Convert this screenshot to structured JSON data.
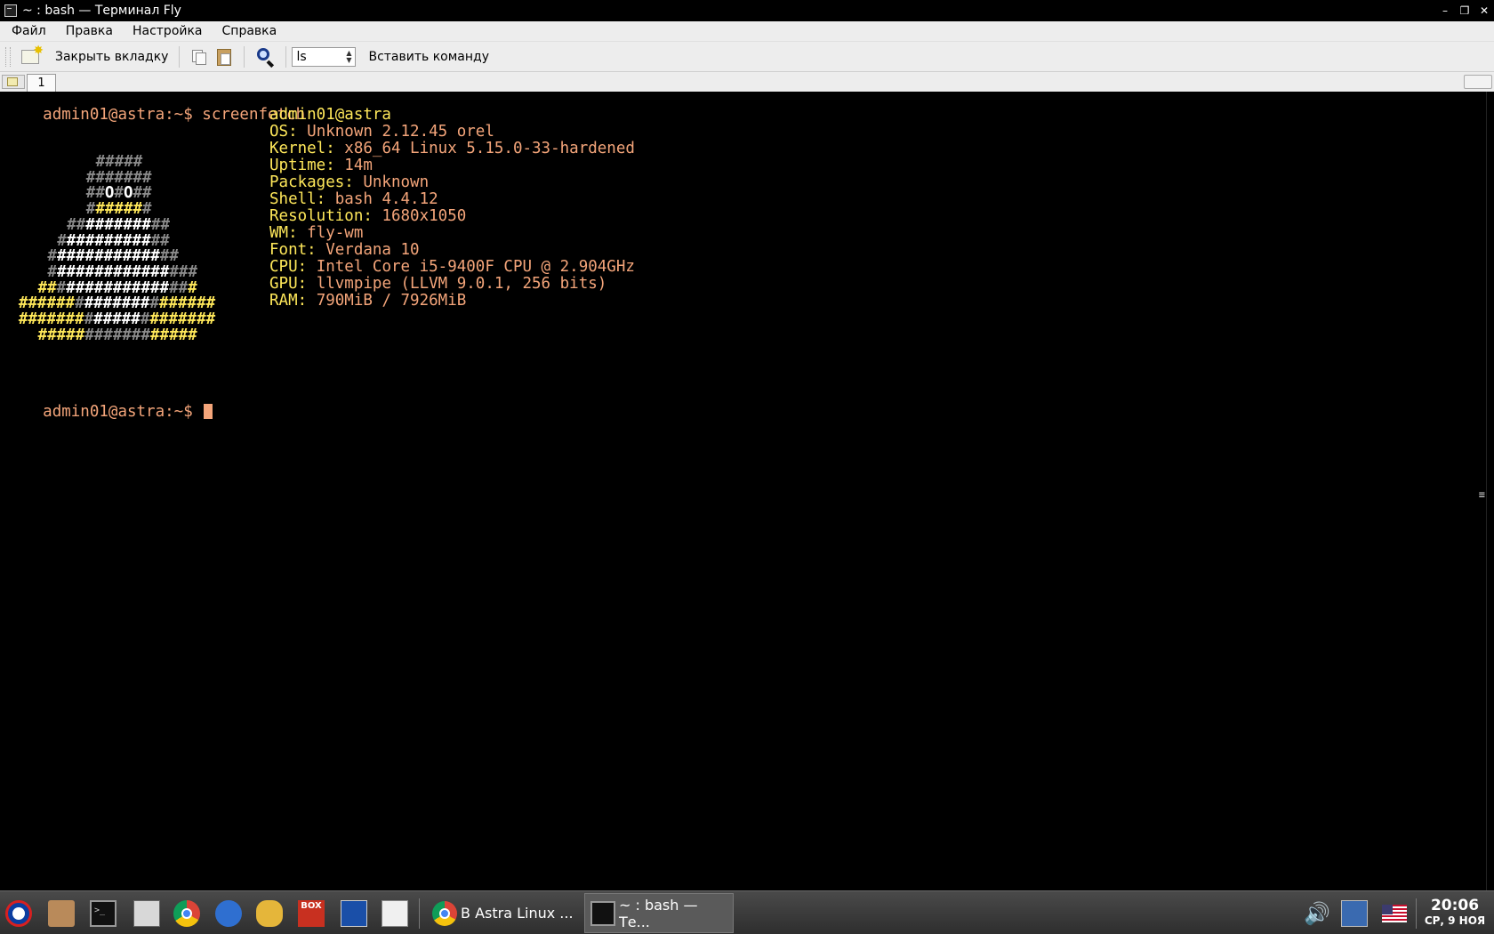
{
  "window": {
    "title": "~ : bash — Терминал Fly",
    "minimize": "–",
    "maximize": "❐",
    "close": "✕"
  },
  "menu": [
    "Файл",
    "Правка",
    "Настройка",
    "Справка"
  ],
  "toolbar": {
    "close_tab_label": "Закрыть вкладку",
    "command_select": "ls",
    "insert_command_label": "Вставить команду"
  },
  "tabs": [
    {
      "label": "1"
    }
  ],
  "terminal": {
    "prompt": "admin01@astra:~$ ",
    "command": "screenfetch",
    "info": [
      {
        "key": "",
        "value": "admin01@astra"
      },
      {
        "key": "OS: ",
        "value": "Unknown 2.12.45 orel"
      },
      {
        "key": "Kernel: ",
        "value": "x86_64 Linux 5.15.0-33-hardened"
      },
      {
        "key": "Uptime: ",
        "value": "14m"
      },
      {
        "key": "Packages: ",
        "value": "Unknown"
      },
      {
        "key": "Shell: ",
        "value": "bash 4.4.12"
      },
      {
        "key": "Resolution: ",
        "value": "1680x1050"
      },
      {
        "key": "WM: ",
        "value": "fly-wm"
      },
      {
        "key": "Font: ",
        "value": "Verdana 10"
      },
      {
        "key": "CPU: ",
        "value": "Intel Core i5-9400F CPU @ 2.904GHz"
      },
      {
        "key": "GPU: ",
        "value": "llvmpipe (LLVM 9.0.1, 256 bits)"
      },
      {
        "key": "RAM: ",
        "value": "790MiB / 7926MiB"
      }
    ],
    "logo": [
      [
        [
          "grey",
          "#####"
        ]
      ],
      [
        [
          "grey",
          "#######"
        ]
      ],
      [
        [
          "grey",
          "##"
        ],
        [
          "white",
          "O"
        ],
        [
          "grey",
          "#"
        ],
        [
          "white",
          "O"
        ],
        [
          "grey",
          "##"
        ]
      ],
      [
        [
          "grey",
          "#"
        ],
        [
          "yellow",
          "#####"
        ],
        [
          "grey",
          "#"
        ]
      ],
      [
        [
          "grey",
          "##"
        ],
        [
          "white",
          "#######"
        ],
        [
          "grey",
          "##"
        ]
      ],
      [
        [
          "grey",
          "#"
        ],
        [
          "white",
          "#########"
        ],
        [
          "grey",
          "##"
        ]
      ],
      [
        [
          "grey",
          "#"
        ],
        [
          "white",
          "###########"
        ],
        [
          "grey",
          "##"
        ]
      ],
      [
        [
          "grey",
          "#"
        ],
        [
          "white",
          "############"
        ],
        [
          "grey",
          "###"
        ]
      ],
      [
        [
          "yellow",
          "##"
        ],
        [
          "grey",
          "#"
        ],
        [
          "white",
          "###########"
        ],
        [
          "grey",
          "##"
        ],
        [
          "yellow",
          "#"
        ]
      ],
      [
        [
          "yellow",
          "######"
        ],
        [
          "grey",
          "#"
        ],
        [
          "white",
          "#######"
        ],
        [
          "grey",
          "#"
        ],
        [
          "yellow",
          "######"
        ]
      ],
      [
        [
          "yellow",
          "#######"
        ],
        [
          "grey",
          "#"
        ],
        [
          "white",
          "#####"
        ],
        [
          "grey",
          "#"
        ],
        [
          "yellow",
          "#######"
        ]
      ],
      [
        [
          "yellow",
          "#####"
        ],
        [
          "grey",
          "#######"
        ],
        [
          "yellow",
          "#####"
        ]
      ]
    ],
    "logo_offsets": [
      9,
      8,
      8,
      8,
      6,
      5,
      4,
      4,
      3,
      1,
      1,
      3
    ]
  },
  "taskbar": {
    "tasks": [
      {
        "label": "В Astra Linux ..."
      },
      {
        "label": "~ : bash — Те..."
      }
    ],
    "box_icon_text": "BOX",
    "volume_icon": "🔊",
    "clock": {
      "time": "20:06",
      "date": "СР, 9 НОЯ"
    }
  }
}
